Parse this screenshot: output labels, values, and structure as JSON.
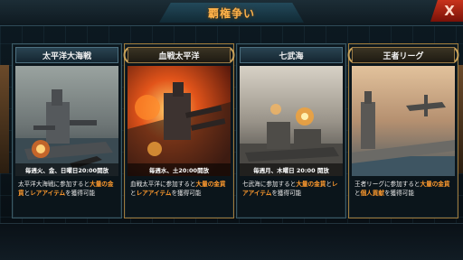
{
  "header": {
    "title": "覇権争い"
  },
  "close_label": "X",
  "cards": [
    {
      "title": "太平洋大海戦",
      "schedule": "毎週火、金、日曜日20:00開放",
      "desc": [
        {
          "t": "太平洋大海戦に参加すると"
        },
        {
          "t": "大量の",
          "hl": true
        },
        {
          "t": "金貨",
          "hl": true
        },
        {
          "t": "と"
        },
        {
          "t": "レアアイテム",
          "hl": true
        },
        {
          "t": "を獲得可能"
        }
      ]
    },
    {
      "title": "血戦太平洋",
      "schedule": "毎週水、土20:00開放",
      "desc": [
        {
          "t": "血戦太平洋に参加すると"
        },
        {
          "t": "大量の金",
          "hl": true
        },
        {
          "t": "貨",
          "hl": true
        },
        {
          "t": "と"
        },
        {
          "t": "レアアイテム",
          "hl": true
        },
        {
          "t": "を獲得可能"
        }
      ]
    },
    {
      "title": "七武海",
      "schedule": "毎週月、木曜日 20:00 開放",
      "desc": [
        {
          "t": "七武海に参加すると"
        },
        {
          "t": "大量の金貨",
          "hl": true
        },
        {
          "t": "と"
        },
        {
          "t": "レアアイテム",
          "hl": true
        },
        {
          "t": "を獲得可能"
        }
      ]
    },
    {
      "title": "王者リーグ",
      "schedule": "",
      "desc": [
        {
          "t": "王者リーグに参加すると"
        },
        {
          "t": "大量の金",
          "hl": true
        },
        {
          "t": "貨",
          "hl": true
        },
        {
          "t": "と"
        },
        {
          "t": "個人貢献",
          "hl": true
        },
        {
          "t": "を獲得可能"
        }
      ]
    }
  ],
  "colors": {
    "accent": "#ff9a2e",
    "title": "#ffb24a",
    "close": "#c8331c"
  }
}
